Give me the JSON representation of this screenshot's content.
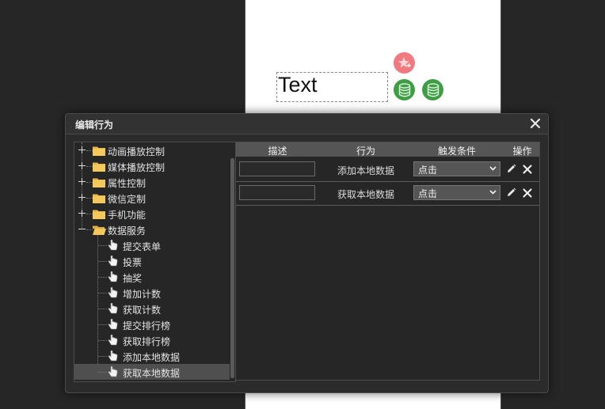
{
  "canvas": {
    "text_element": "Text",
    "fab_colors": {
      "star": "#f07a80",
      "database": "#3f9e45"
    }
  },
  "dialog": {
    "title": "编辑行为",
    "tree": [
      {
        "label": "动画播放控制",
        "type": "folder",
        "expanded": false
      },
      {
        "label": "媒体播放控制",
        "type": "folder",
        "expanded": false
      },
      {
        "label": "属性控制",
        "type": "folder",
        "expanded": false
      },
      {
        "label": "微信定制",
        "type": "folder",
        "expanded": false
      },
      {
        "label": "手机功能",
        "type": "folder",
        "expanded": false
      },
      {
        "label": "数据服务",
        "type": "folder",
        "expanded": true
      },
      {
        "label": "提交表单",
        "type": "leaf"
      },
      {
        "label": "投票",
        "type": "leaf"
      },
      {
        "label": "抽奖",
        "type": "leaf"
      },
      {
        "label": "增加计数",
        "type": "leaf"
      },
      {
        "label": "获取计数",
        "type": "leaf"
      },
      {
        "label": "提交排行榜",
        "type": "leaf"
      },
      {
        "label": "获取排行榜",
        "type": "leaf"
      },
      {
        "label": "添加本地数据",
        "type": "leaf"
      },
      {
        "label": "获取本地数据",
        "type": "leaf",
        "selected": true
      }
    ],
    "table": {
      "headers": [
        "描述",
        "行为",
        "触发条件",
        "操作"
      ],
      "rows": [
        {
          "description": "",
          "action": "添加本地数据",
          "trigger": "点击"
        },
        {
          "description": "",
          "action": "获取本地数据",
          "trigger": "点击"
        }
      ]
    }
  }
}
